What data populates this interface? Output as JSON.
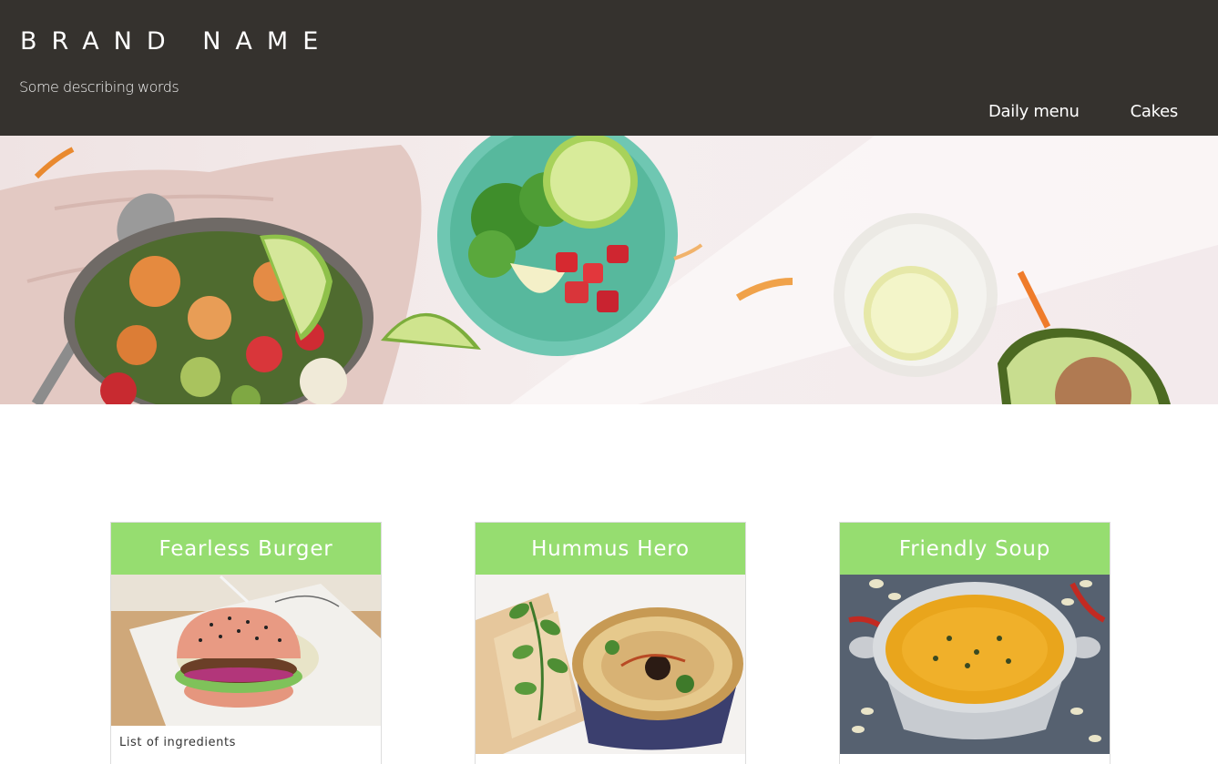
{
  "header": {
    "brand": "BRAND NAME",
    "tagline": "Some describing words",
    "nav": [
      {
        "label": "Daily menu"
      },
      {
        "label": "Cakes"
      }
    ]
  },
  "hero": {
    "image": "healthy-food-flatlay-photo"
  },
  "cards": [
    {
      "title": "Fearless Burger",
      "image": "burger-photo",
      "caption": "List of ingredients"
    },
    {
      "title": "Hummus Hero",
      "image": "hummus-photo",
      "caption": ""
    },
    {
      "title": "Friendly Soup",
      "image": "soup-photo",
      "caption": ""
    }
  ],
  "colors": {
    "header_bg": "#35322e",
    "card_title_bg": "#96dd70"
  }
}
